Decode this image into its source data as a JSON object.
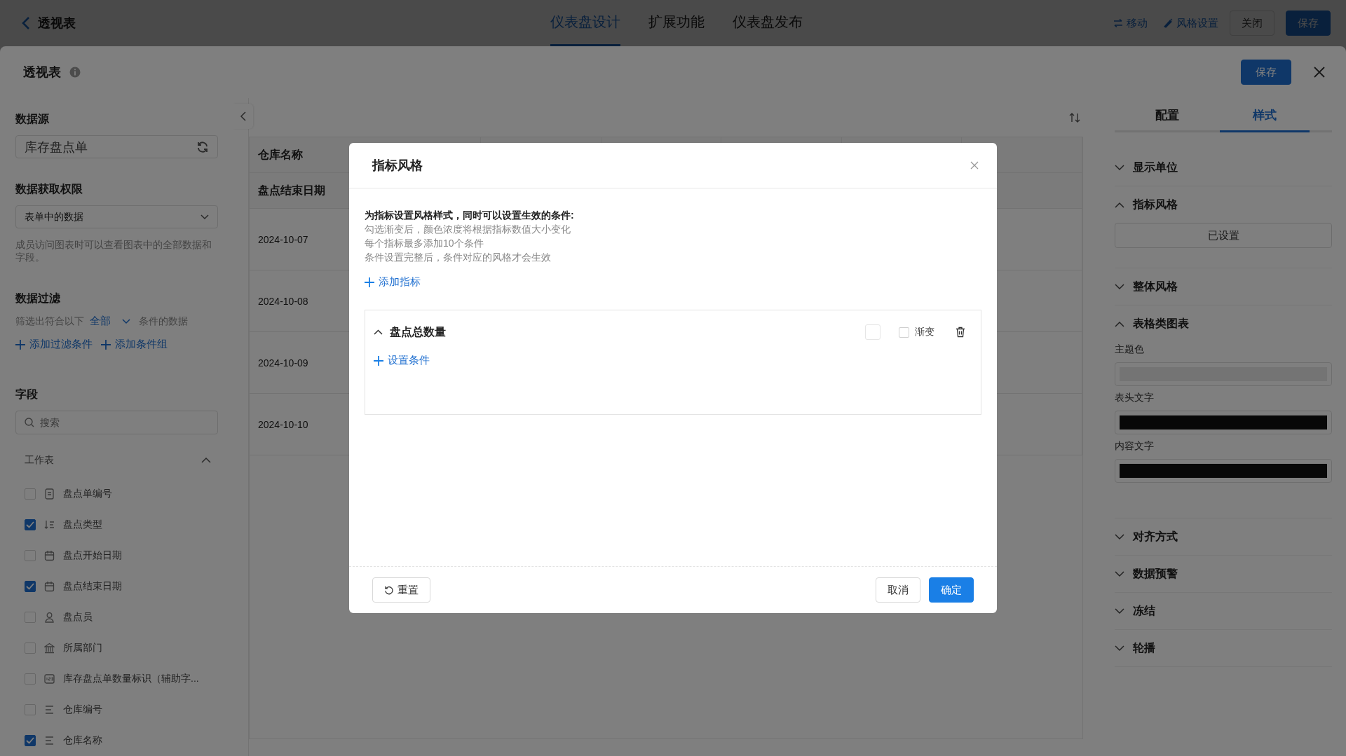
{
  "top_bar": {
    "title": "透视表",
    "tabs": [
      {
        "label": "仪表盘设计",
        "selected": true
      },
      {
        "label": "扩展功能",
        "selected": false
      },
      {
        "label": "仪表盘发布",
        "selected": false
      }
    ],
    "actions": [
      {
        "kind": "move",
        "label": "移动"
      },
      {
        "kind": "style",
        "label": "风格设置"
      }
    ],
    "close": "关闭",
    "save": "保存"
  },
  "drawer": {
    "title": "透视表",
    "save": "保存"
  },
  "left": {
    "data_source": {
      "title": "数据源",
      "value": "库存盘点单"
    },
    "permission": {
      "title": "数据获取权限",
      "value": "表单中的数据",
      "hint": "成员访问图表时可以查看图表中的全部数据和字段。"
    },
    "filter": {
      "title": "数据过滤",
      "prefix": "筛选出符合以下",
      "match": "全部",
      "suffix": "条件的数据",
      "add_condition": "添加过滤条件",
      "add_group": "添加条件组"
    },
    "fields": {
      "title": "字段",
      "search_placeholder": "搜索",
      "group": {
        "label": "工作表",
        "expanded": true
      },
      "items": [
        {
          "label": "盘点单编号",
          "checked": false,
          "kind": "serial"
        },
        {
          "label": "盘点类型",
          "checked": true,
          "kind": "select"
        },
        {
          "label": "盘点开始日期",
          "checked": false,
          "kind": "date"
        },
        {
          "label": "盘点结束日期",
          "checked": true,
          "kind": "date"
        },
        {
          "label": "盘点员",
          "checked": false,
          "kind": "person"
        },
        {
          "label": "所属部门",
          "checked": false,
          "kind": "department"
        },
        {
          "label": "库存盘点单数量标识（辅助字...",
          "checked": false,
          "kind": "number"
        },
        {
          "label": "仓库编号",
          "checked": false,
          "kind": "text"
        },
        {
          "label": "仓库名称",
          "checked": true,
          "kind": "text"
        }
      ]
    }
  },
  "table": {
    "header_rows": [
      "仓库名称",
      "盘点结束日期"
    ],
    "rows": [
      "2024-10-07",
      "2024-10-08",
      "2024-10-09",
      "2024-10-10"
    ]
  },
  "right": {
    "tabs": [
      {
        "label": "配置",
        "selected": false
      },
      {
        "label": "样式",
        "selected": true
      }
    ],
    "sections": [
      {
        "title": "显示单位",
        "expanded": false
      },
      {
        "title": "指标风格",
        "expanded": true,
        "button": "已设置"
      },
      {
        "title": "整体风格",
        "expanded": false
      },
      {
        "title": "表格类图表",
        "expanded": true,
        "colors": [
          {
            "label": "主题色",
            "kind": "light"
          },
          {
            "label": "表头文字",
            "kind": "dark"
          },
          {
            "label": "内容文字",
            "kind": "dark"
          }
        ]
      },
      {
        "title": "对齐方式",
        "expanded": false
      },
      {
        "title": "数据预警",
        "expanded": false
      },
      {
        "title": "冻结",
        "expanded": false
      },
      {
        "title": "轮播",
        "expanded": false
      }
    ]
  },
  "modal": {
    "title": "指标风格",
    "intro": "为指标设置风格样式，同时可以设置生效的条件:",
    "notes": [
      "勾选渐变后，颜色浓度将根据指标数值大小变化",
      "每个指标最多添加10个条件",
      "条件设置完整后，条件对应的风格才会生效"
    ],
    "add_metric": "添加指标",
    "metrics": [
      {
        "name": "盘点总数量",
        "expanded": true,
        "gradient": false,
        "gradient_label": "渐变",
        "add_condition": "设置条件"
      }
    ],
    "reset": "重置",
    "cancel": "取消",
    "ok": "确定"
  }
}
